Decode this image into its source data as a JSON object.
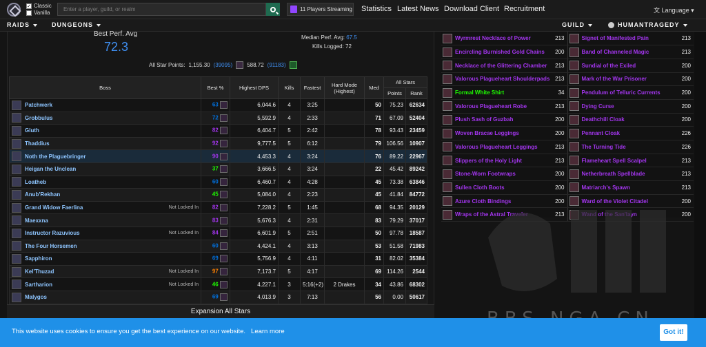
{
  "topbar": {
    "classic_label": "Classic",
    "vanilla_label": "Vanilla",
    "search_placeholder": "Enter a player, guild, or realm",
    "streaming": "11 Players Streaming",
    "links": [
      "Statistics",
      "Latest News",
      "Download Client",
      "Recruitment"
    ],
    "language": "Language"
  },
  "nav": {
    "raids": "RAIDS",
    "dungeons": "DUNGEONS",
    "guild": "GUILD",
    "user": "HUMANTRAGEDY"
  },
  "summary": {
    "best_title": "Best Perf. Avg",
    "best_value": "72.3",
    "median_label": "Median Perf. Avg:",
    "median_value": "67.5",
    "kills_label": "Kills Logged:",
    "kills_value": "72",
    "asp_label": "All Star Points:",
    "asp1": "1,155.30",
    "asp1_rank": "(39095)",
    "asp2": "588.72",
    "asp2_rank": "(91183)"
  },
  "table": {
    "headers": {
      "boss": "Boss",
      "best": "Best %",
      "dps": "Highest DPS",
      "kills": "Kills",
      "fastest": "Fastest",
      "hard": "Hard Mode (Highest)",
      "med": "Med",
      "allstars": "All Stars",
      "points": "Points",
      "rank": "Rank"
    },
    "rows": [
      {
        "boss": "Patchwerk",
        "note": "",
        "best": "63",
        "dps": "6,044.6",
        "kills": "4",
        "fastest": "3:25",
        "hard": "",
        "med": "50",
        "points": "75.23",
        "rank": "62634"
      },
      {
        "boss": "Grobbulus",
        "note": "",
        "best": "72",
        "dps": "5,592.9",
        "kills": "4",
        "fastest": "2:33",
        "hard": "",
        "med": "71",
        "points": "67.09",
        "rank": "52404"
      },
      {
        "boss": "Gluth",
        "note": "",
        "best": "82",
        "dps": "6,404.7",
        "kills": "5",
        "fastest": "2:42",
        "hard": "",
        "med": "78",
        "points": "93.43",
        "rank": "23459"
      },
      {
        "boss": "Thaddius",
        "note": "",
        "best": "92",
        "dps": "9,777.5",
        "kills": "5",
        "fastest": "6:12",
        "hard": "",
        "med": "79",
        "points": "106.56",
        "rank": "10907"
      },
      {
        "boss": "Noth the Plaguebringer",
        "note": "",
        "best": "90",
        "dps": "4,453.3",
        "kills": "4",
        "fastest": "3:24",
        "hard": "",
        "med": "76",
        "points": "89.22",
        "rank": "22967"
      },
      {
        "boss": "Heigan the Unclean",
        "note": "",
        "best": "37",
        "dps": "3,666.5",
        "kills": "4",
        "fastest": "3:24",
        "hard": "",
        "med": "22",
        "points": "45.42",
        "rank": "89242"
      },
      {
        "boss": "Loatheb",
        "note": "",
        "best": "60",
        "dps": "6,460.7",
        "kills": "4",
        "fastest": "4:28",
        "hard": "",
        "med": "45",
        "points": "73.38",
        "rank": "63846"
      },
      {
        "boss": "Anub'Rekhan",
        "note": "",
        "best": "45",
        "dps": "5,084.0",
        "kills": "4",
        "fastest": "2:23",
        "hard": "",
        "med": "45",
        "points": "41.84",
        "rank": "84772"
      },
      {
        "boss": "Grand Widow Faerlina",
        "note": "Not Locked In",
        "best": "82",
        "dps": "7,228.2",
        "kills": "5",
        "fastest": "1:45",
        "hard": "",
        "med": "68",
        "points": "94.35",
        "rank": "20129"
      },
      {
        "boss": "Maexxna",
        "note": "",
        "best": "83",
        "dps": "5,676.3",
        "kills": "4",
        "fastest": "2:31",
        "hard": "",
        "med": "83",
        "points": "79.29",
        "rank": "37017"
      },
      {
        "boss": "Instructor Razuvious",
        "note": "Not Locked In",
        "best": "84",
        "dps": "6,601.9",
        "kills": "5",
        "fastest": "2:51",
        "hard": "",
        "med": "50",
        "points": "97.78",
        "rank": "18587"
      },
      {
        "boss": "The Four Horsemen",
        "note": "",
        "best": "60",
        "dps": "4,424.1",
        "kills": "4",
        "fastest": "3:13",
        "hard": "",
        "med": "53",
        "points": "51.58",
        "rank": "71983"
      },
      {
        "boss": "Sapphiron",
        "note": "",
        "best": "69",
        "dps": "5,756.9",
        "kills": "4",
        "fastest": "4:11",
        "hard": "",
        "med": "31",
        "points": "82.02",
        "rank": "35384"
      },
      {
        "boss": "Kel'Thuzad",
        "note": "Not Locked In",
        "best": "97",
        "dps": "7,173.7",
        "kills": "5",
        "fastest": "4:17",
        "hard": "",
        "med": "69",
        "points": "114.26",
        "rank": "2544"
      },
      {
        "boss": "Sartharion",
        "note": "Not Locked In",
        "best": "46",
        "dps": "4,227.1",
        "kills": "3",
        "fastest": "5:16(+2)",
        "hard": "2 Drakes",
        "med": "34",
        "points": "43.86",
        "rank": "68302"
      },
      {
        "boss": "Malygos",
        "note": "",
        "best": "69",
        "dps": "4,013.9",
        "kills": "3",
        "fastest": "7:13",
        "hard": "",
        "med": "56",
        "points": "0.00",
        "rank": "50617"
      }
    ]
  },
  "expansion_label": "Expansion All Stars",
  "gear": {
    "left": [
      {
        "name": "Wyrmrest Necklace of Power",
        "ilvl": "213"
      },
      {
        "name": "Encircling Burnished Gold Chains",
        "ilvl": "200"
      },
      {
        "name": "Necklace of the Glittering Chamber",
        "ilvl": "213"
      },
      {
        "name": "Valorous Plagueheart Shoulderpads",
        "ilvl": "213"
      },
      {
        "name": "Formal White Shirt",
        "ilvl": "34"
      },
      {
        "name": "Valorous Plagueheart Robe",
        "ilvl": "213"
      },
      {
        "name": "Plush Sash of Guzbah",
        "ilvl": "200"
      },
      {
        "name": "Woven Bracae Leggings",
        "ilvl": "200"
      },
      {
        "name": "Valorous Plagueheart Leggings",
        "ilvl": "213"
      },
      {
        "name": "Slippers of the Holy Light",
        "ilvl": "213"
      },
      {
        "name": "Stone-Worn Footwraps",
        "ilvl": "200"
      },
      {
        "name": "Sullen Cloth Boots",
        "ilvl": "200"
      },
      {
        "name": "Azure Cloth Bindings",
        "ilvl": "200"
      },
      {
        "name": "Wraps of the Astral Traveler",
        "ilvl": "213"
      }
    ],
    "right": [
      {
        "name": "Signet of Manifested Pain",
        "ilvl": "213"
      },
      {
        "name": "Band of Channeled Magic",
        "ilvl": "213"
      },
      {
        "name": "Sundial of the Exiled",
        "ilvl": "200"
      },
      {
        "name": "Mark of the War Prisoner",
        "ilvl": "200"
      },
      {
        "name": "Pendulum of Telluric Currents",
        "ilvl": "200"
      },
      {
        "name": "Dying Curse",
        "ilvl": "200"
      },
      {
        "name": "Deathchill Cloak",
        "ilvl": "200"
      },
      {
        "name": "Pennant Cloak",
        "ilvl": "226"
      },
      {
        "name": "The Turning Tide",
        "ilvl": "226"
      },
      {
        "name": "Flameheart Spell Scalpel",
        "ilvl": "213"
      },
      {
        "name": "Netherbreath Spellblade",
        "ilvl": "213"
      },
      {
        "name": "Matriarch's Spawn",
        "ilvl": "213"
      },
      {
        "name": "Ward of the Violet Citadel",
        "ilvl": "200"
      },
      {
        "name": "Wand of the San'layn",
        "ilvl": "200"
      }
    ]
  },
  "watermark": {
    "text": "BBS.NGA.CN"
  },
  "cookie": {
    "text": "This website uses cookies to ensure you get the best experience on our website.",
    "learn_more": "Learn more",
    "got_it": "Got it!"
  },
  "colors": {
    "orange": "#ff8000",
    "purple": "#a335ee",
    "blue": "#0070dd",
    "green": "#1eff00",
    "gray": "#9d9d9d",
    "cookie_bg": "#1f90e8"
  }
}
